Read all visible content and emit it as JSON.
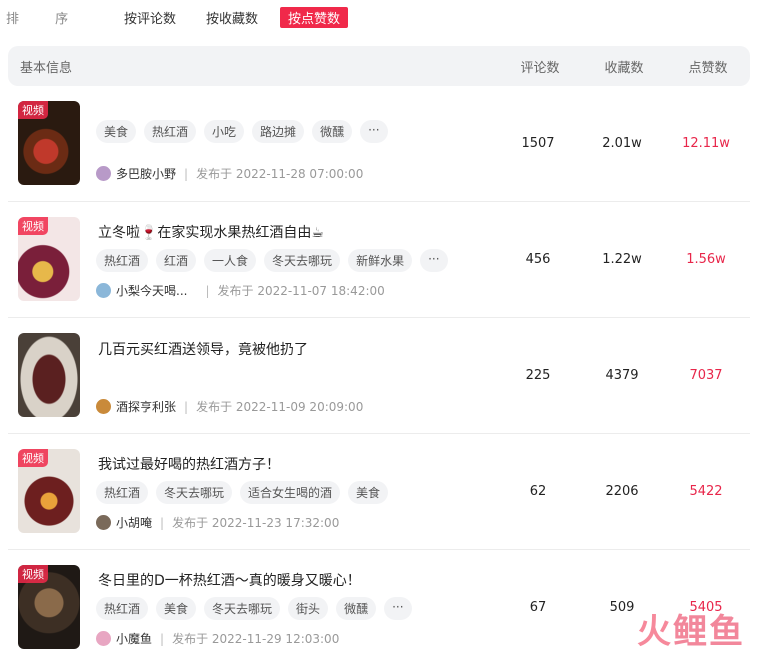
{
  "sort": {
    "label": "排 序",
    "tabs": [
      "按评论数",
      "按收藏数",
      "按点赞数"
    ],
    "active_index": 2
  },
  "header": {
    "info": "基本信息",
    "col_comments": "评论数",
    "col_favorites": "收藏数",
    "col_likes": "点赞数"
  },
  "rows": [
    {
      "badge": "视频",
      "title": "",
      "tags": [
        "美食",
        "热红酒",
        "小吃",
        "路边摊",
        "微醺",
        "···"
      ],
      "author": "多巴胺小野",
      "published": "发布于  2022-11-28 07:00:00",
      "comments": "1507",
      "favorites": "2.01w",
      "likes": "12.11w"
    },
    {
      "badge": "视频",
      "title": "立冬啦🍷在家实现水果热红酒自由☕",
      "tags": [
        "热红酒",
        "红酒",
        "一人食",
        "冬天去哪玩",
        "新鲜水果",
        "···"
      ],
      "author": "小梨今天喝...",
      "published": "发布于  2022-11-07 18:42:00",
      "comments": "456",
      "favorites": "1.22w",
      "likes": "1.56w"
    },
    {
      "badge": "",
      "title": "几百元买红酒送领导，竟被他扔了",
      "tags": [],
      "author": "酒探亨利张",
      "published": "发布于  2022-11-09 20:09:00",
      "comments": "225",
      "favorites": "4379",
      "likes": "7037"
    },
    {
      "badge": "视频",
      "title": "我试过最好喝的热红酒方子！",
      "tags": [
        "热红酒",
        "冬天去哪玩",
        "适合女生喝的酒",
        "美食"
      ],
      "author": "小胡唵",
      "published": "发布于  2022-11-23 17:32:00",
      "comments": "62",
      "favorites": "2206",
      "likes": "5422"
    },
    {
      "badge": "视频",
      "title": "冬日里的D一杯热红酒～真的暖身又暖心！",
      "tags": [
        "热红酒",
        "美食",
        "冬天去哪玩",
        "街头",
        "微醺",
        "···"
      ],
      "author": "小魔鱼",
      "published": "发布于  2022-11-29 12:03:00",
      "comments": "67",
      "favorites": "509",
      "likes": "5405"
    }
  ],
  "watermark": {
    "part1": "火",
    "part2": "鲤鱼"
  },
  "colors": {
    "accent": "#f0294a",
    "likes": "#e8264a",
    "header_bg": "#f2f3f5"
  }
}
